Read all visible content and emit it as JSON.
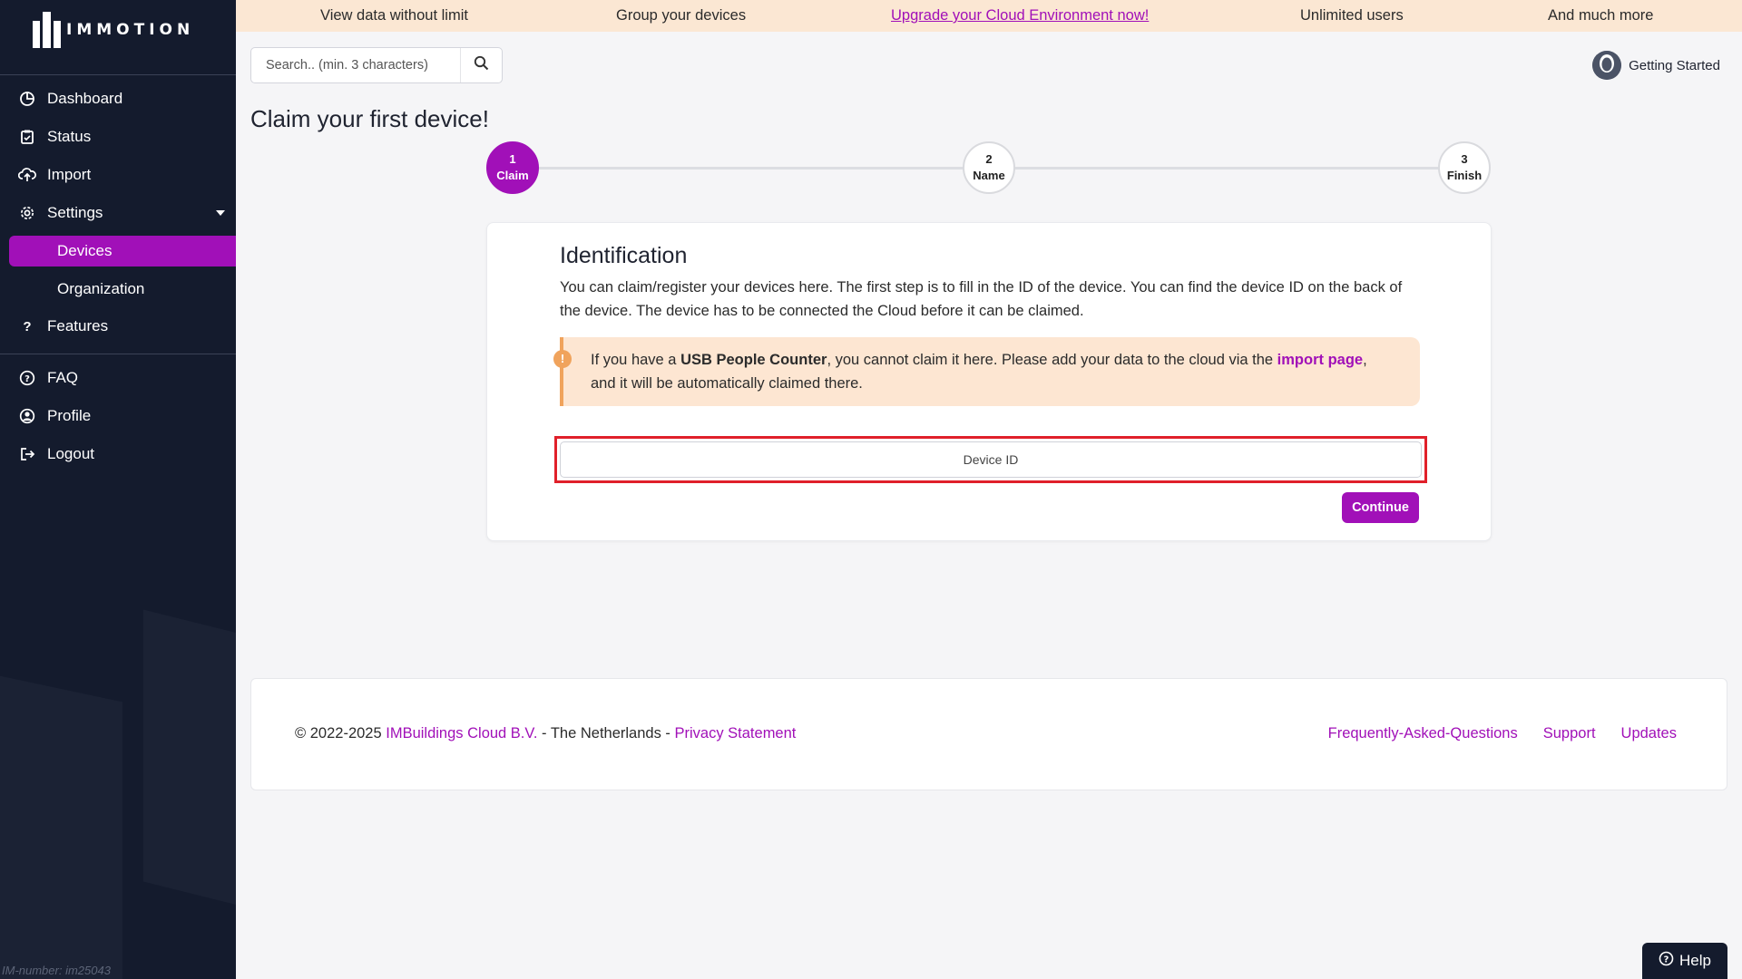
{
  "brand": {
    "name": "IMMOTION",
    "im_number": "IM-number: im25043",
    "accent_color": "#a110b8",
    "sidebar_color": "#141b2d"
  },
  "banner": {
    "items": [
      "View data without limit",
      "Group your devices",
      "Upgrade your Cloud Environment now!",
      "Unlimited users",
      "And much more"
    ]
  },
  "sidebar": {
    "items": [
      {
        "label": "Dashboard",
        "icon": "dashboard-icon"
      },
      {
        "label": "Status",
        "icon": "clipboard-icon"
      },
      {
        "label": "Import",
        "icon": "cloud-upload-icon"
      },
      {
        "label": "Settings",
        "icon": "gear-icon"
      },
      {
        "label": "Devices",
        "icon": ""
      },
      {
        "label": "Organization",
        "icon": ""
      },
      {
        "label": "Features",
        "icon": "question-icon"
      },
      {
        "label": "FAQ",
        "icon": "help-circle-icon"
      },
      {
        "label": "Profile",
        "icon": "user-circle-icon"
      },
      {
        "label": "Logout",
        "icon": "logout-icon"
      }
    ]
  },
  "search": {
    "placeholder": "Search.. (min. 3 characters)"
  },
  "user": {
    "label": "Getting Started"
  },
  "page": {
    "title": "Claim your first device!"
  },
  "stepper": {
    "steps": [
      {
        "num": "1",
        "label": "Claim",
        "active": true
      },
      {
        "num": "2",
        "label": "Name",
        "active": false
      },
      {
        "num": "3",
        "label": "Finish",
        "active": false
      }
    ]
  },
  "card": {
    "heading": "Identification",
    "description": "You can claim/register your devices here. The first step is to fill in the ID of the device. You can find the device ID on the back of the device. The device has to be connected the Cloud before it can be claimed.",
    "alert": {
      "prefix": "If you have a ",
      "bold": "USB People Counter",
      "middle": ", you cannot claim it here. Please add your data to the cloud via the ",
      "link": "import page",
      "suffix": ", and it will be automatically claimed there."
    },
    "device_id_placeholder": "Device ID",
    "device_id_value": "",
    "continue_label": "Continue"
  },
  "footer": {
    "copyright": "© 2022-2025 ",
    "company": "IMBuildings Cloud B.V.",
    "country": " - The Netherlands - ",
    "privacy": "Privacy Statement",
    "links": [
      "Frequently-Asked-Questions",
      "Support",
      "Updates"
    ]
  },
  "help": {
    "label": "Help"
  }
}
